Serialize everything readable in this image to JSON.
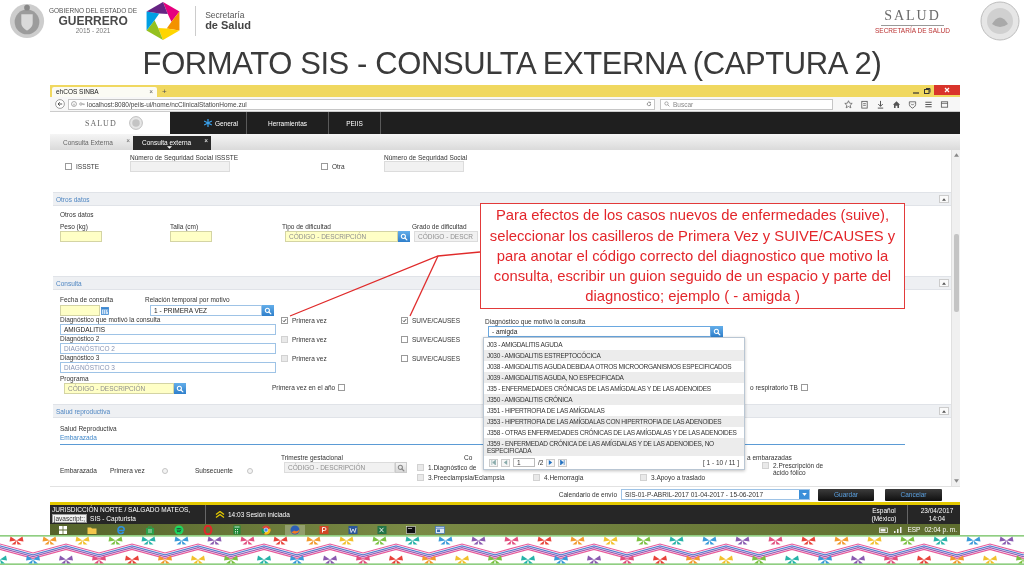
{
  "slide": {
    "title": "FORMATO SIS - CONSULTA EXTERNA (CAPTURA 2)"
  },
  "logos": {
    "state": {
      "line1": "GOBIERNO DEL ESTADO DE",
      "line2": "GUERRERO",
      "years": "2015 - 2021"
    },
    "secretaria": {
      "line1": "Secretaría",
      "line2": "de Salud"
    },
    "salud": {
      "name": "SALUD",
      "tagline": "SECRETARÍA DE SALUD"
    }
  },
  "browser": {
    "tab": {
      "title": "ehCOS SINBA",
      "close": "×"
    },
    "new_tab": "+",
    "url": "localhost:8080/peiis-ui/home/ncClinicalStationHome.zul",
    "search": {
      "placeholder": "Buscar"
    }
  },
  "app_header": {
    "logo": "SALUD",
    "menu": [
      {
        "label": "General",
        "kind": "icon"
      },
      {
        "label": "Herramientas",
        "kind": "text"
      },
      {
        "label": "PEIIS",
        "kind": "text"
      }
    ]
  },
  "tabs": [
    {
      "label": "Consulta Externa",
      "close": "×",
      "selected": false
    },
    {
      "label": "Consulta externa",
      "close": "×",
      "selected": true
    }
  ],
  "insurance": [
    {
      "label": "ISSSTE",
      "checked": false,
      "number_label": "Número de Seguridad Social ISSSTE"
    },
    {
      "label": "Otra",
      "checked": false,
      "number_label": "Número de Seguridad Social"
    }
  ],
  "otros_datos": {
    "title": "Otros datos",
    "subtitle": "Otros datos",
    "fields": [
      {
        "label": "Peso (kg)",
        "kind": "input"
      },
      {
        "label": "Talla (cm)",
        "kind": "input"
      },
      {
        "label": "Tipo de dificultad",
        "kind": "lookup",
        "placeholder": "CÓDIGO - DESCRIPCIÓN"
      },
      {
        "label": "Grado de dificultad",
        "kind": "locked",
        "placeholder": "CÓDIGO - DESCR"
      }
    ]
  },
  "consulta": {
    "title": "Consulta",
    "date": {
      "label": "Fecha de consulta"
    },
    "relation": {
      "label": "Relación temporal por motivo",
      "value": "1 - PRIMERA VEZ"
    },
    "diagnoses": [
      {
        "label": "Diagnóstico que motivó la consulta",
        "value": "AMIGDALITIS",
        "first_time": {
          "label": "Primera vez",
          "checked": true,
          "disabled": false
        },
        "suive": {
          "label": "SUIVE/CAUSES",
          "checked": true
        }
      },
      {
        "label": "Diagnóstico 2",
        "placeholder": "DIAGNÓSTICO 2",
        "first_time": {
          "label": "Primera vez",
          "checked": false,
          "disabled": true
        },
        "suive": {
          "label": "SUIVE/CAUSES",
          "checked": false
        }
      },
      {
        "label": "Diagnóstico 3",
        "placeholder": "DIAGNÓSTICO 3",
        "first_time": {
          "label": "Primera vez",
          "checked": false,
          "disabled": true
        },
        "suive": {
          "label": "SUIVE/CAUSES",
          "checked": false
        }
      }
    ],
    "program": {
      "label": "Programa",
      "placeholder": "CÓDIGO - DESCRIPCIÓN"
    },
    "first_in_year": {
      "label": "Primera vez en el año",
      "checked": false
    },
    "tb": {
      "label": "o respiratorio TB",
      "checked": false
    },
    "search": {
      "label": "Diagnóstico que motivó la consulta",
      "value": "- amigda",
      "results": [
        "J03 - AMIGDALITIS AGUDA",
        "J030 - AMIGDALITIS ESTREPTOCÓCICA",
        "J038 - AMIGDALITIS AGUDA DEBIDA A OTROS MICROORGANISMOS ESPECIFICADOS",
        "J039 - AMIGDALITIS AGUDA, NO ESPECIFICADA",
        "J35 - ENFERMEDADES CRÓNICAS DE LAS AMÍGDALAS Y DE LAS ADENOIDES",
        "J350 - AMIGDALITIS CRÓNICA",
        "J351 - HIPERTROFIA DE LAS AMÍGDALAS",
        "J353 - HIPERTROFIA DE LAS AMÍGDALAS CON HIPERTROFIA DE LAS ADENOIDES",
        "J358 - OTRAS ENFERMEDADES CRÓNICAS DE LAS AMÍGDALAS Y DE LAS ADENOIDES",
        "J359 - ENFERMEDAD CRÓNICA DE LAS AMÍGDALAS Y DE LAS ADENOIDES, NO ESPECIFICADA"
      ],
      "pager": {
        "page": "1",
        "total": "/2",
        "range": "[ 1 - 10 / 11 ]"
      }
    }
  },
  "salud_reproductiva": {
    "title": "Salud reproductiva",
    "subtitle": "Salud Reproductiva",
    "tabs": [
      {
        "label": "Embarazada",
        "selected": true
      }
    ],
    "row_label": "Embarazada",
    "visit": [
      {
        "label": "Primera vez",
        "selected": false
      },
      {
        "label": "Subsecuente",
        "selected": false
      }
    ],
    "trimester": {
      "label": "Trimestre gestacional",
      "placeholder": "CÓDIGO - DESCRIPCIÓN"
    },
    "complications": {
      "label": "Co",
      "rows": [
        [
          {
            "label": "1.Diagnóstico de",
            "checked": false
          }
        ],
        [
          {
            "label": "3.Preeclampsia/Eclampsia",
            "checked": false
          },
          {
            "label": "4.Hemorragia",
            "checked": false
          },
          {
            "label": "3.Apoyo a traslado",
            "checked": false
          }
        ]
      ]
    },
    "care": {
      "label": "a embarazadas",
      "options": [
        {
          "label": "2.Prescripción de ácido fólico",
          "checked": false
        }
      ]
    }
  },
  "footer": {
    "calendar": {
      "label": "Calendario de envío",
      "value": "SIS-01-P-ABRIL-2017 01-04-2017 - 15-06-2017"
    },
    "buttons": [
      "Guardar",
      "Cancelar"
    ]
  },
  "status_bar": {
    "user": "JURISDICCIÓN NORTE / SALGADO MATEOS,",
    "tooltip": "javascript:;",
    "role": "SIS - Capturista",
    "session": "14:03 Sesión iniciada",
    "language": "Español (México)",
    "date": "23/04/2017",
    "time": "14:04"
  },
  "taskbar": {
    "language": "ESP",
    "time": "02:04 p. m."
  },
  "callout": {
    "text": "Para efectos de los casos nuevos de enfermedades (suive), seleccionar los casilleros de Primera Vez y SUIVE/CAUSES y para anotar el código correcto del diagnostico que motivo la consulta, escribir un guion seguido de un espacio y parte del diagnostico; ejemplo ( - amigda )"
  }
}
